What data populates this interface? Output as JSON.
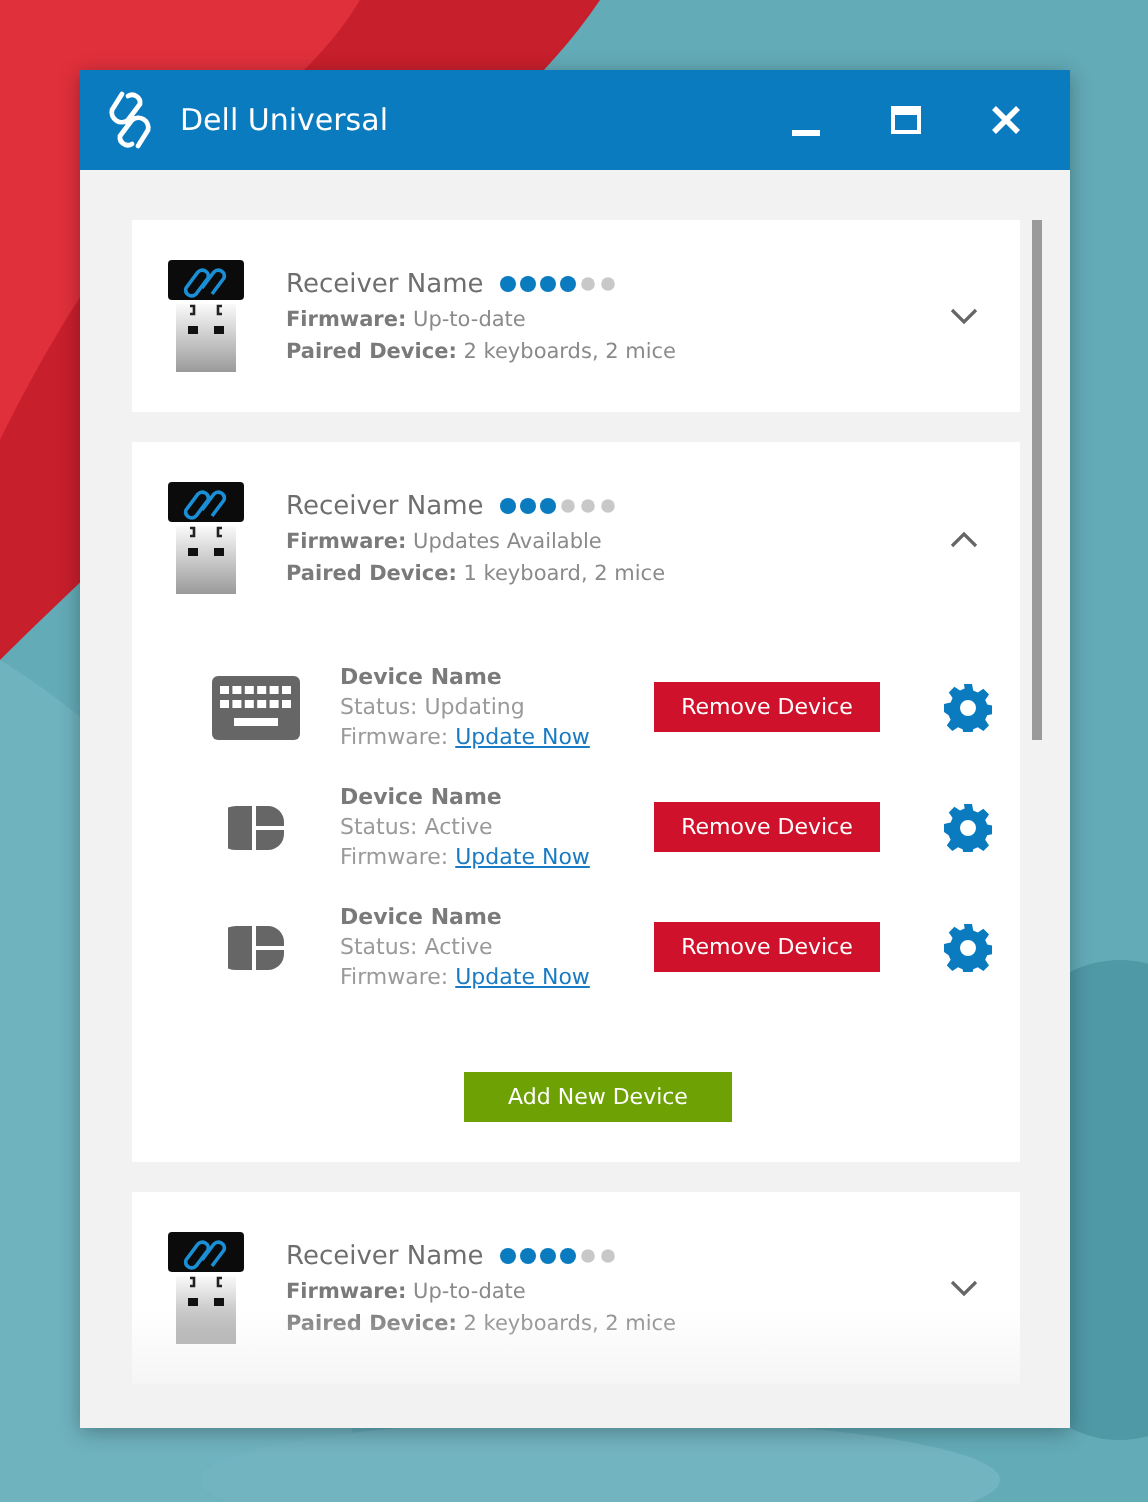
{
  "window": {
    "title": "Dell Universal"
  },
  "receivers": [
    {
      "name": "Receiver Name",
      "stars": 4,
      "firmware_label": "Firmware:",
      "firmware": "Up-to-date",
      "paired_label": "Paired Device:",
      "paired": "2 keyboards, 2 mice",
      "expanded": false
    },
    {
      "name": "Receiver Name",
      "stars": 3,
      "firmware_label": "Firmware:",
      "firmware": "Updates Available",
      "paired_label": "Paired Device:",
      "paired": "1 keyboard, 2 mice",
      "expanded": true,
      "devices": [
        {
          "kind": "keyboard",
          "name": "Device Name",
          "status": "Status: Updating",
          "firmware_label": "Firmware:",
          "firmware_link": "Update Now",
          "remove_button": "Remove Device"
        },
        {
          "kind": "mouse",
          "name": "Device Name",
          "status": "Status: Active",
          "firmware_label": "Firmware:",
          "firmware_link": "Update Now",
          "remove_button": "Remove Device"
        },
        {
          "kind": "mouse",
          "name": "Device Name",
          "status": "Status: Active",
          "firmware_label": "Firmware:",
          "firmware_link": "Update Now",
          "remove_button": "Remove Device"
        }
      ],
      "add_button": "Add New Device"
    },
    {
      "name": "Receiver Name",
      "stars": 4,
      "firmware_label": "Firmware:",
      "firmware": "Up-to-date",
      "paired_label": "Paired Device:",
      "paired": "2 keyboards, 2 mice",
      "expanded": false
    }
  ]
}
